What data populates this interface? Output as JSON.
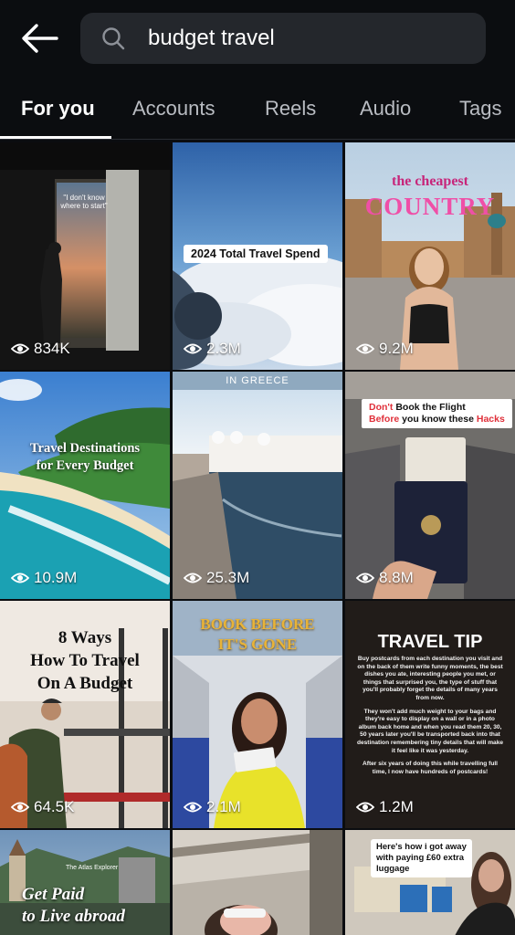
{
  "search": {
    "query": "budget travel"
  },
  "tabs": [
    "For you",
    "Accounts",
    "Reels",
    "Audio",
    "Tags"
  ],
  "tiles": {
    "t1": {
      "views": "834K",
      "quote": "\"I don't know where to start\""
    },
    "t2": {
      "views": "2.3M",
      "caption": "2024 Total Travel Spend"
    },
    "t3": {
      "views": "9.2M",
      "line1": "the cheapest",
      "line2": "COUNTRY"
    },
    "t4": {
      "views": "10.9M",
      "line1": "Travel Destinations",
      "line2": "for Every Budget"
    },
    "t5": {
      "views": "25.3M",
      "header": "IN GREECE"
    },
    "t6": {
      "views": "8.8M",
      "line1a": "Don't",
      "line1b": " Book the Flight",
      "line2a": "Before",
      "line2b": " you know these ",
      "line2c": "Hacks"
    },
    "t7": {
      "views": "64.5K",
      "line1": "8 Ways",
      "line2": "How To Travel",
      "line3": "On A Budget"
    },
    "t8": {
      "views": "2.1M",
      "line1": "BOOK BEFORE",
      "line2": "IT'S GONE"
    },
    "t9": {
      "views": "1.2M",
      "title": "TRAVEL TIP",
      "p1": "Buy postcards from each destination you visit and on the back of them write funny moments, the best dishes you ate, interesting people you met, or things that surprised you, the type of stuff that you'll probably forget the details of many years from now.",
      "p2": "They won't add much weight to your bags and they're easy to display on a wall or in a photo album back home and when you read them 20, 30, 50 years later you'll be transported back into that destination remembering tiny details that will make it feel like it was yesterday.",
      "p3": "After six years of doing this while travelling full time, I now have hundreds of postcards!"
    },
    "t10": {
      "brand": "The Atlas Explorer",
      "line1": "Get Paid",
      "line2": "to Live abroad"
    },
    "t12": {
      "line1": "Here's how i got away",
      "line2": "with paying £60 extra",
      "line3": "luggage"
    }
  },
  "colors": {
    "background": "#0b0d10",
    "search_bg": "#24272c",
    "tab_inactive": "#b9bcc2",
    "accent_red": "#e0303a",
    "gold": "#d9a72a"
  },
  "icons": {
    "back": "arrow-left-icon",
    "search": "search-icon",
    "views": "eye-icon"
  }
}
